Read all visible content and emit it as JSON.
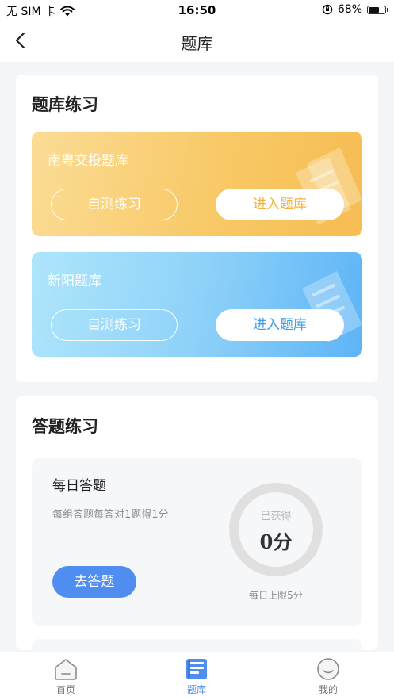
{
  "status_bar": {
    "carrier": "无 SIM 卡",
    "time": "16:50",
    "battery": "68%",
    "battery_level": 0.68
  },
  "nav": {
    "title": "题库"
  },
  "bank_section": {
    "title": "题库练习",
    "cards": [
      {
        "name": "南粤交投题库",
        "self_test_label": "自测练习",
        "enter_label": "进入题库",
        "color": "#f8c967"
      },
      {
        "name": "新阳题库",
        "self_test_label": "自测练习",
        "enter_label": "进入题库",
        "color": "#8fd2f9"
      }
    ]
  },
  "answer_section": {
    "title": "答题练习",
    "daily": {
      "title": "每日答题",
      "description": "每组答题每答对1题得1分",
      "button_label": "去答题",
      "score_label": "已获得",
      "score_value": "0分",
      "daily_limit": "每日上限5分",
      "score_fraction": 0
    }
  },
  "tab_bar": {
    "items": [
      {
        "label": "首页",
        "icon": "home-icon"
      },
      {
        "label": "题库",
        "icon": "question-bank-icon",
        "active": true
      },
      {
        "label": "我的",
        "icon": "smiley-profile-icon"
      }
    ],
    "accent_color": "#4f8ef0"
  }
}
